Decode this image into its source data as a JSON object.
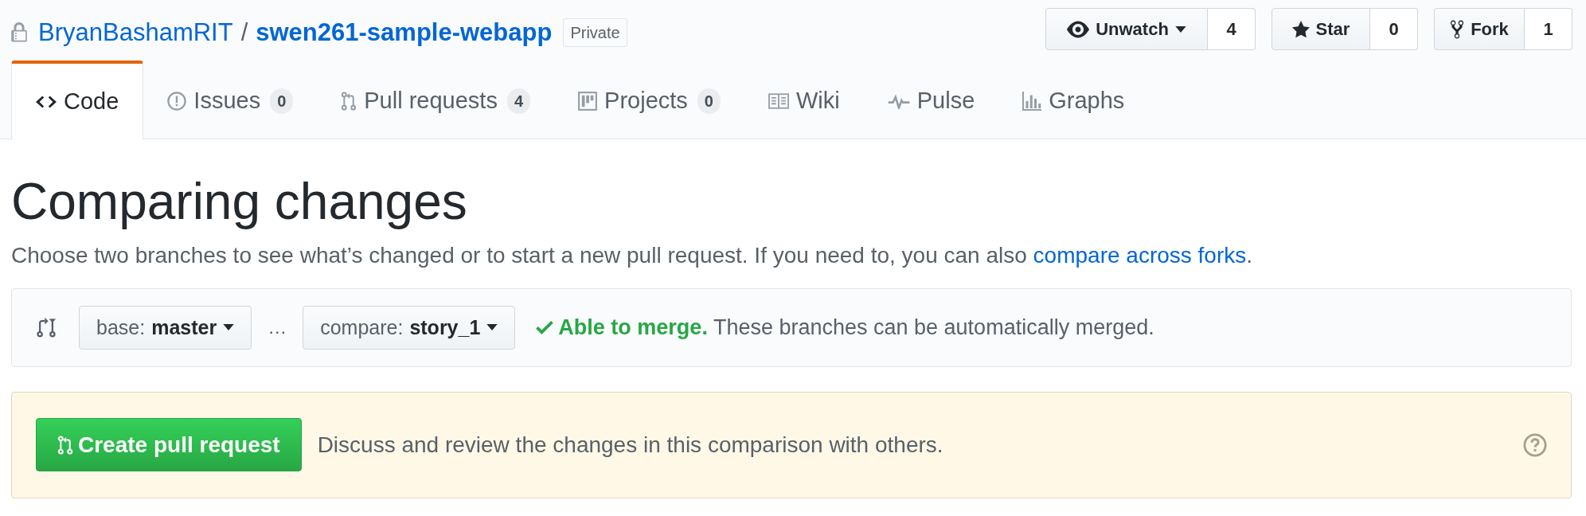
{
  "repo": {
    "owner": "BryanBashamRIT",
    "separator": "/",
    "name": "swen261-sample-webapp",
    "badge": "Private"
  },
  "actions": [
    {
      "kind": "watch",
      "label": "Unwatch",
      "dropdown": true,
      "count": "4"
    },
    {
      "kind": "star",
      "label": "Star",
      "dropdown": false,
      "count": "0"
    },
    {
      "kind": "fork",
      "label": "Fork",
      "dropdown": false,
      "count": "1"
    }
  ],
  "tabs": [
    {
      "kind": "code",
      "label": "Code",
      "selected": true
    },
    {
      "kind": "issues",
      "label": "Issues",
      "count": "0",
      "selected": false
    },
    {
      "kind": "pulls",
      "label": "Pull requests",
      "count": "4",
      "selected": false
    },
    {
      "kind": "projects",
      "label": "Projects",
      "count": "0",
      "selected": false
    },
    {
      "kind": "wiki",
      "label": "Wiki",
      "selected": false
    },
    {
      "kind": "pulse",
      "label": "Pulse",
      "selected": false
    },
    {
      "kind": "graphs",
      "label": "Graphs",
      "selected": false
    }
  ],
  "heading": "Comparing changes",
  "description": {
    "text": "Choose two branches to see what’s changed or to start a new pull request. If you need to, you can also",
    "link": "compare across forks",
    "end": "."
  },
  "compare": {
    "base_prefix": "base:",
    "base": "master",
    "dots": "…",
    "compare_prefix": "compare:",
    "compare": "story_1",
    "status_title": "Able to merge.",
    "status_text": "These branches can be automatically merged."
  },
  "create": {
    "button": "Create pull request",
    "text": "Discuss and review the changes in this comparison with others."
  }
}
